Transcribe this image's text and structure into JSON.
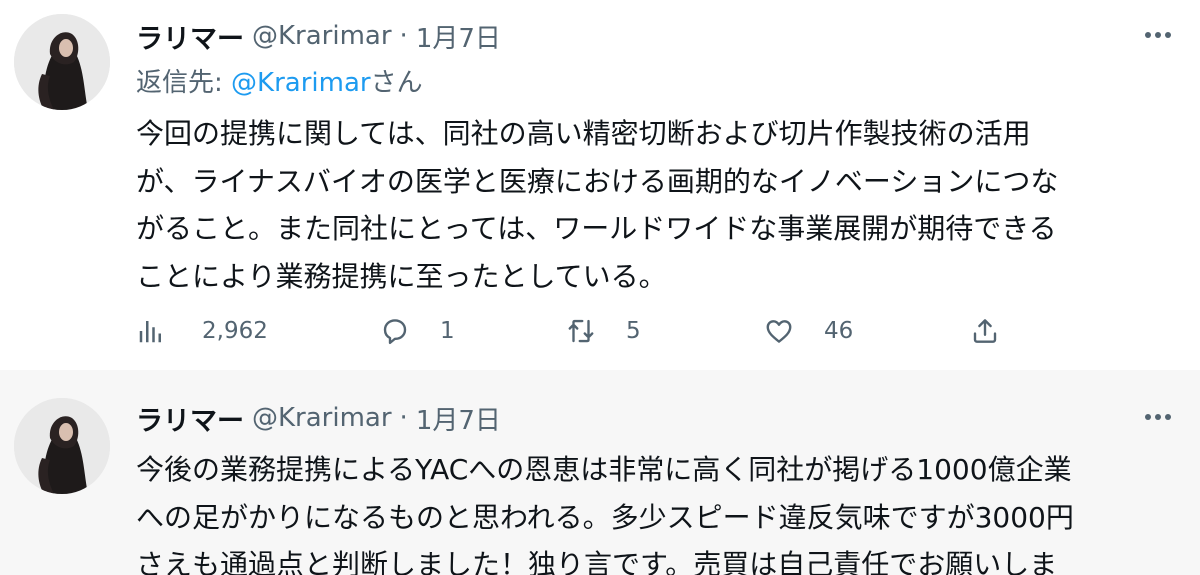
{
  "tweets": [
    {
      "display_name": "ラリマー",
      "handle": "@Krarimar",
      "separator": "·",
      "date": "1月7日",
      "avatar_icon": "avatar-photo",
      "more_icon": "more-horizontal-icon",
      "replying_to": {
        "prefix": "返信先: ",
        "mention": "@Krarimar",
        "suffix": "さん"
      },
      "text": "今回の提携に関しては、同社の高い精密切断および切片作製技術の活用\nが、ライナスバイオの医学と医療における画期的なイノベーションにつな\nがること。また同社にとっては、ワールドワイドな事業展開が期待できる\nことにより業務提携に至ったとしている。",
      "actions": {
        "views": {
          "icon": "analytics-icon",
          "count": "2,962"
        },
        "reply": {
          "icon": "reply-icon",
          "count": "1"
        },
        "retweet": {
          "icon": "retweet-icon",
          "count": "5"
        },
        "like": {
          "icon": "like-icon",
          "count": "46"
        },
        "share": {
          "icon": "share-icon"
        }
      }
    },
    {
      "display_name": "ラリマー",
      "handle": "@Krarimar",
      "separator": "·",
      "date": "1月7日",
      "avatar_icon": "avatar-photo",
      "more_icon": "more-horizontal-icon",
      "text": "今後の業務提携によるYACへの恩恵は非常に高く同社が掲げる1000億企業\nへの足がかりになるものと思われる。多少スピード違反気味ですが3000円\nさえも通過点と判断しました！独り言です。売買は自己責任でお願いしま"
    }
  ],
  "colors": {
    "text_primary": "#0f1419",
    "text_secondary": "#536471",
    "link": "#1d9bf0",
    "thread_line": "#cfd9de",
    "highlight_bg": "#f7f7f7"
  }
}
